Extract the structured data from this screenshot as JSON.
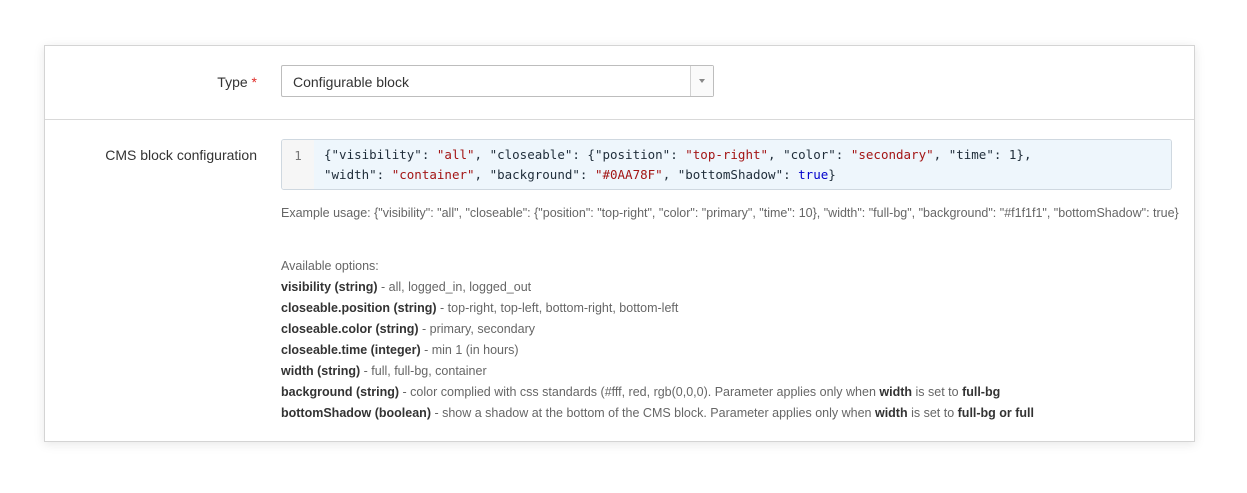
{
  "type_field": {
    "label": "Type",
    "required_mark": "*",
    "selected": "Configurable block"
  },
  "config_field": {
    "label": "CMS block configuration",
    "line_number": "1",
    "code": {
      "line1": {
        "p1": "{\"visibility\": ",
        "s1": "\"all\"",
        "p2": ", \"closeable\": {\"position\": ",
        "s2": "\"top-right\"",
        "p3": ", \"color\": ",
        "s3": "\"secondary\"",
        "p4": ", \"time\": 1},"
      },
      "line2": {
        "p1": "\"width\": ",
        "s1": "\"container\"",
        "p2": ", \"background\": ",
        "s2": "\"#0AA78F\"",
        "p3": ", \"bottomShadow\": ",
        "b1": "true",
        "p4": "}"
      }
    },
    "example_usage": "Example usage: {\"visibility\": \"all\", \"closeable\": {\"position\": \"top-right\", \"color\": \"primary\", \"time\": 10}, \"width\": \"full-bg\", \"background\": \"#f1f1f1\", \"bottomShadow\": true}",
    "available_title": "Available options:",
    "options": [
      {
        "name": "visibility (string)",
        "desc": " - all, logged_in, logged_out"
      },
      {
        "name": "closeable.position (string)",
        "desc": " - top-right, top-left, bottom-right, bottom-left"
      },
      {
        "name": "closeable.color (string)",
        "desc": " - primary, secondary"
      },
      {
        "name": "closeable.time (integer)",
        "desc": " - min 1 (in hours)"
      },
      {
        "name": "width (string)",
        "desc": " - full, full-bg, container"
      }
    ],
    "background_option": {
      "name": "background (string)",
      "desc": " - color complied with css standards (#fff, red, rgb(0,0,0). Parameter applies only when ",
      "em1": "width",
      "mid": " is set to ",
      "em2": "full-bg"
    },
    "shadow_option": {
      "name": "bottomShadow (boolean)",
      "desc": " - show a shadow at the bottom of the CMS block. Parameter applies only when ",
      "em1": "width",
      "mid": " is set to ",
      "em2": "full-bg or full"
    }
  },
  "colors": {
    "required": "#e02b27",
    "string": "#a31515",
    "boolean": "#0000cc",
    "editor_bg": "#eef6fc"
  }
}
